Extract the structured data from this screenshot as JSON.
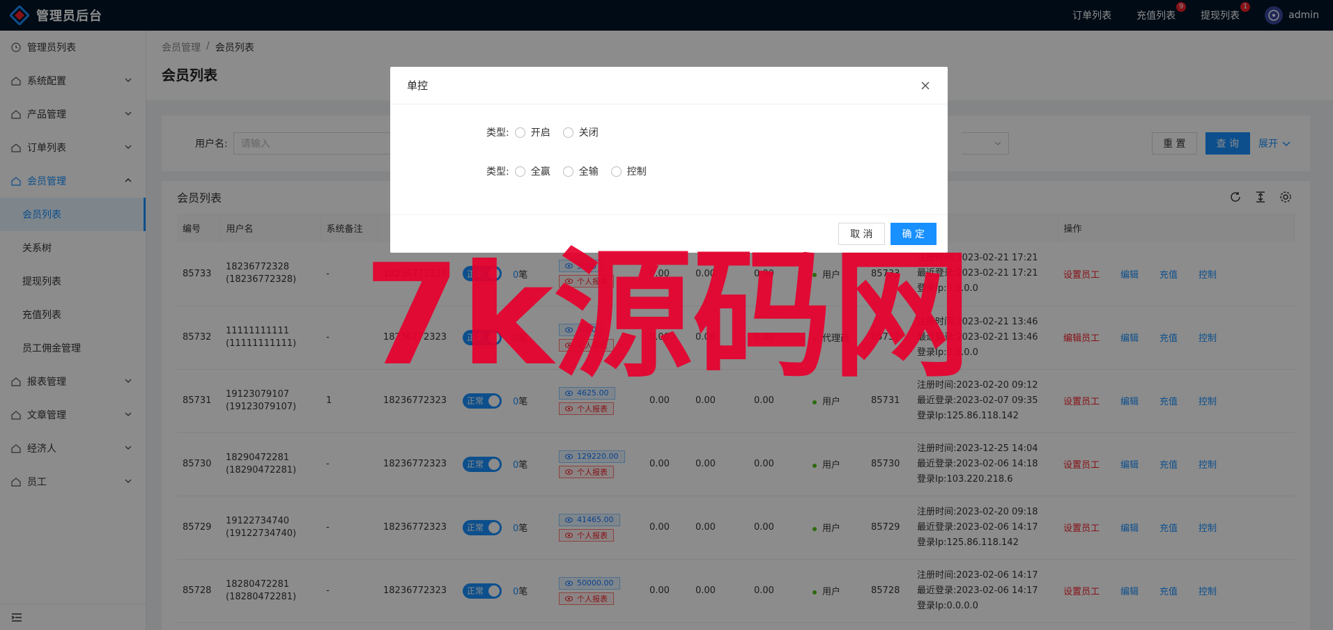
{
  "header": {
    "app_title": "管理员后台",
    "links": [
      {
        "label": "订单列表",
        "badge": ""
      },
      {
        "label": "充值列表",
        "badge": "9"
      },
      {
        "label": "提现列表",
        "badge": "1"
      }
    ],
    "user_name": "admin"
  },
  "sidebar": {
    "items": [
      {
        "label": "管理员列表",
        "icon": "clock-icon",
        "expandable": false
      },
      {
        "label": "系统配置",
        "icon": "home-icon",
        "expandable": true
      },
      {
        "label": "产品管理",
        "icon": "home-icon",
        "expandable": true
      },
      {
        "label": "订单列表",
        "icon": "home-icon",
        "expandable": true
      },
      {
        "label": "会员管理",
        "icon": "home-icon",
        "expandable": true,
        "open": true
      }
    ],
    "sub_items": [
      "会员列表",
      "关系树",
      "提现列表",
      "充值列表",
      "员工佣金管理"
    ],
    "items_after": [
      {
        "label": "报表管理",
        "icon": "home-icon"
      },
      {
        "label": "文章管理",
        "icon": "home-icon"
      },
      {
        "label": "经济人",
        "icon": "home-icon"
      },
      {
        "label": "员工",
        "icon": "home-icon"
      }
    ]
  },
  "breadcrumb": {
    "parent": "会员管理",
    "separator": "/",
    "current": "会员列表"
  },
  "page_title": "会员列表",
  "search": {
    "label": "用户名:",
    "placeholder": "请输入",
    "reset_label": "重 置",
    "query_label": "查 询",
    "expand_label": "展开"
  },
  "table": {
    "title": "会员列表",
    "headers": [
      "编号",
      "用户名",
      "系统备注",
      "",
      "",
      "",
      "",
      "",
      "",
      "",
      "",
      "",
      "",
      "操作"
    ],
    "rows": [
      {
        "id": "85733",
        "user": "18236772328",
        "user_sub": "(18236772328)",
        "remark": "-",
        "referrer": "18236772323",
        "status": "正常",
        "count": "0",
        "count_unit": "笔",
        "amount": "3000",
        "report": "个人报表",
        "v1": "0.00",
        "v2": "0.00",
        "v3": "0.00",
        "role": "用户",
        "rid": "85733",
        "reg": "注册时间:2023-02-21 17:21",
        "last": "最近登录:2023-02-21 17:21",
        "ip": "登录Ip:0.0.0.0",
        "op1": "设置员工"
      },
      {
        "id": "85732",
        "user": "11111111111",
        "user_sub": "(11111111111)",
        "remark": "-",
        "referrer": "18236772323",
        "status": "正常",
        "count": "0",
        "count_unit": "笔",
        "amount": "3000",
        "report": "个人报表",
        "v1": "0.00",
        "v2": "0.00",
        "v3": "0.00",
        "role": "代理商",
        "rid": "85732",
        "reg": "注册时间:2023-02-21 13:46",
        "last": "最近登录:2023-02-21 13:46",
        "ip": "登录Ip:0.0.0.0",
        "op1": "编辑员工"
      },
      {
        "id": "85731",
        "user": "19123079107",
        "user_sub": "(19123079107)",
        "remark": "1",
        "referrer": "18236772323",
        "status": "正常",
        "count": "0",
        "count_unit": "笔",
        "amount": "4625.00",
        "report": "个人报表",
        "v1": "0.00",
        "v2": "0.00",
        "v3": "0.00",
        "role": "用户",
        "rid": "85731",
        "reg": "注册时间:2023-02-20 09:12",
        "last": "最近登录:2023-02-07 09:35",
        "ip": "登录Ip:125.86.118.142",
        "op1": "设置员工"
      },
      {
        "id": "85730",
        "user": "18290472281",
        "user_sub": "(18290472281)",
        "remark": "-",
        "referrer": "18236772323",
        "status": "正常",
        "count": "0",
        "count_unit": "笔",
        "amount": "129220.00",
        "report": "个人报表",
        "v1": "0.00",
        "v2": "0.00",
        "v3": "0.00",
        "role": "用户",
        "rid": "85730",
        "reg": "注册时间:2023-12-25 14:04",
        "last": "最近登录:2023-02-06 14:18",
        "ip": "登录Ip:103.220.218.6",
        "op1": "设置员工"
      },
      {
        "id": "85729",
        "user": "19122734740",
        "user_sub": "(19122734740)",
        "remark": "-",
        "referrer": "18236772323",
        "status": "正常",
        "count": "0",
        "count_unit": "笔",
        "amount": "41465.00",
        "report": "个人报表",
        "v1": "0.00",
        "v2": "0.00",
        "v3": "0.00",
        "role": "用户",
        "rid": "85729",
        "reg": "注册时间:2023-02-20 09:18",
        "last": "最近登录:2023-02-06 14:17",
        "ip": "登录Ip:125.86.118.142",
        "op1": "设置员工"
      },
      {
        "id": "85728",
        "user": "18280472281",
        "user_sub": "(18280472281)",
        "remark": "-",
        "referrer": "18236772323",
        "status": "正常",
        "count": "0",
        "count_unit": "笔",
        "amount": "50000.00",
        "report": "个人报表",
        "v1": "0.00",
        "v2": "0.00",
        "v3": "0.00",
        "role": "用户",
        "rid": "85728",
        "reg": "注册时间:2023-02-06 14:17",
        "last": "最近登录:2023-02-06 14:17",
        "ip": "登录Ip:0.0.0.0",
        "op1": "设置员工"
      }
    ],
    "ops": [
      "编辑",
      "充值",
      "控制"
    ]
  },
  "modal": {
    "title": "单控",
    "row1": {
      "label": "类型:",
      "options": [
        "开启",
        "关闭"
      ]
    },
    "row2": {
      "label": "类型:",
      "options": [
        "全赢",
        "全输",
        "控制"
      ]
    },
    "cancel_label": "取 消",
    "ok_label": "确 定"
  },
  "watermark": "7k源码网",
  "colors": {
    "primary": "#1890ff",
    "danger": "#f5222d",
    "header_bg": "#001529",
    "watermark": "#e8002d"
  }
}
